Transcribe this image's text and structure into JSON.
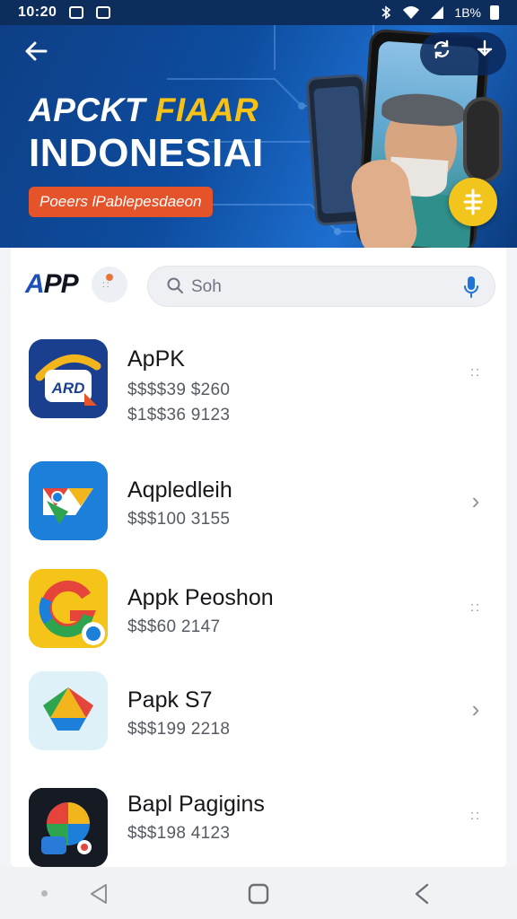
{
  "status_bar": {
    "time": "10:20",
    "right_text": "1B%",
    "icons": [
      "mail-icon",
      "notification-icon",
      "bluetooth-icon",
      "wifi-icon",
      "signal-icon",
      "battery-icon"
    ]
  },
  "banner": {
    "back_icon": "arrow-left-icon",
    "title_line1_white": "APCKT ",
    "title_line1_accent": "FIAAR",
    "title_line2": "INDONESIAI",
    "promo_label": "Poeers lPablepesdaeon",
    "actions": [
      "sync-icon",
      "download-icon"
    ],
    "coin_icon": "coin-icon",
    "colors": {
      "background": "#0d4c9e",
      "accent": "#f6c218",
      "promo": "#e4532a",
      "coin": "#f2c51d"
    }
  },
  "header": {
    "logo": {
      "a": "A",
      "pp": "PP"
    },
    "menu_icon": "menu-icon",
    "search": {
      "placeholder": "Soh",
      "icon": "search-icon",
      "mic_icon": "mic-icon"
    }
  },
  "apps": [
    {
      "name": "ApPK",
      "meta": [
        "$$$$39 $260",
        "$1$$36 9123"
      ],
      "icon_text": "ARD",
      "action": "grip"
    },
    {
      "name": "Aqpledleih",
      "meta": [
        "$$$100 3155"
      ],
      "icon_text": "",
      "action": "chevron"
    },
    {
      "name": "Appk Peoshon",
      "meta": [
        "$$$60 2147"
      ],
      "icon_text": "G",
      "action": "grip"
    },
    {
      "name": "Papk S7",
      "meta": [
        "$$$199 2218"
      ],
      "icon_text": "",
      "action": "chevron"
    },
    {
      "name": "Bapl Pagigins",
      "meta": [
        "$$$198 4123"
      ],
      "icon_text": "",
      "action": "grip"
    }
  ],
  "nav_bar": {
    "buttons": [
      "back-icon",
      "home-icon",
      "recents-icon"
    ]
  }
}
